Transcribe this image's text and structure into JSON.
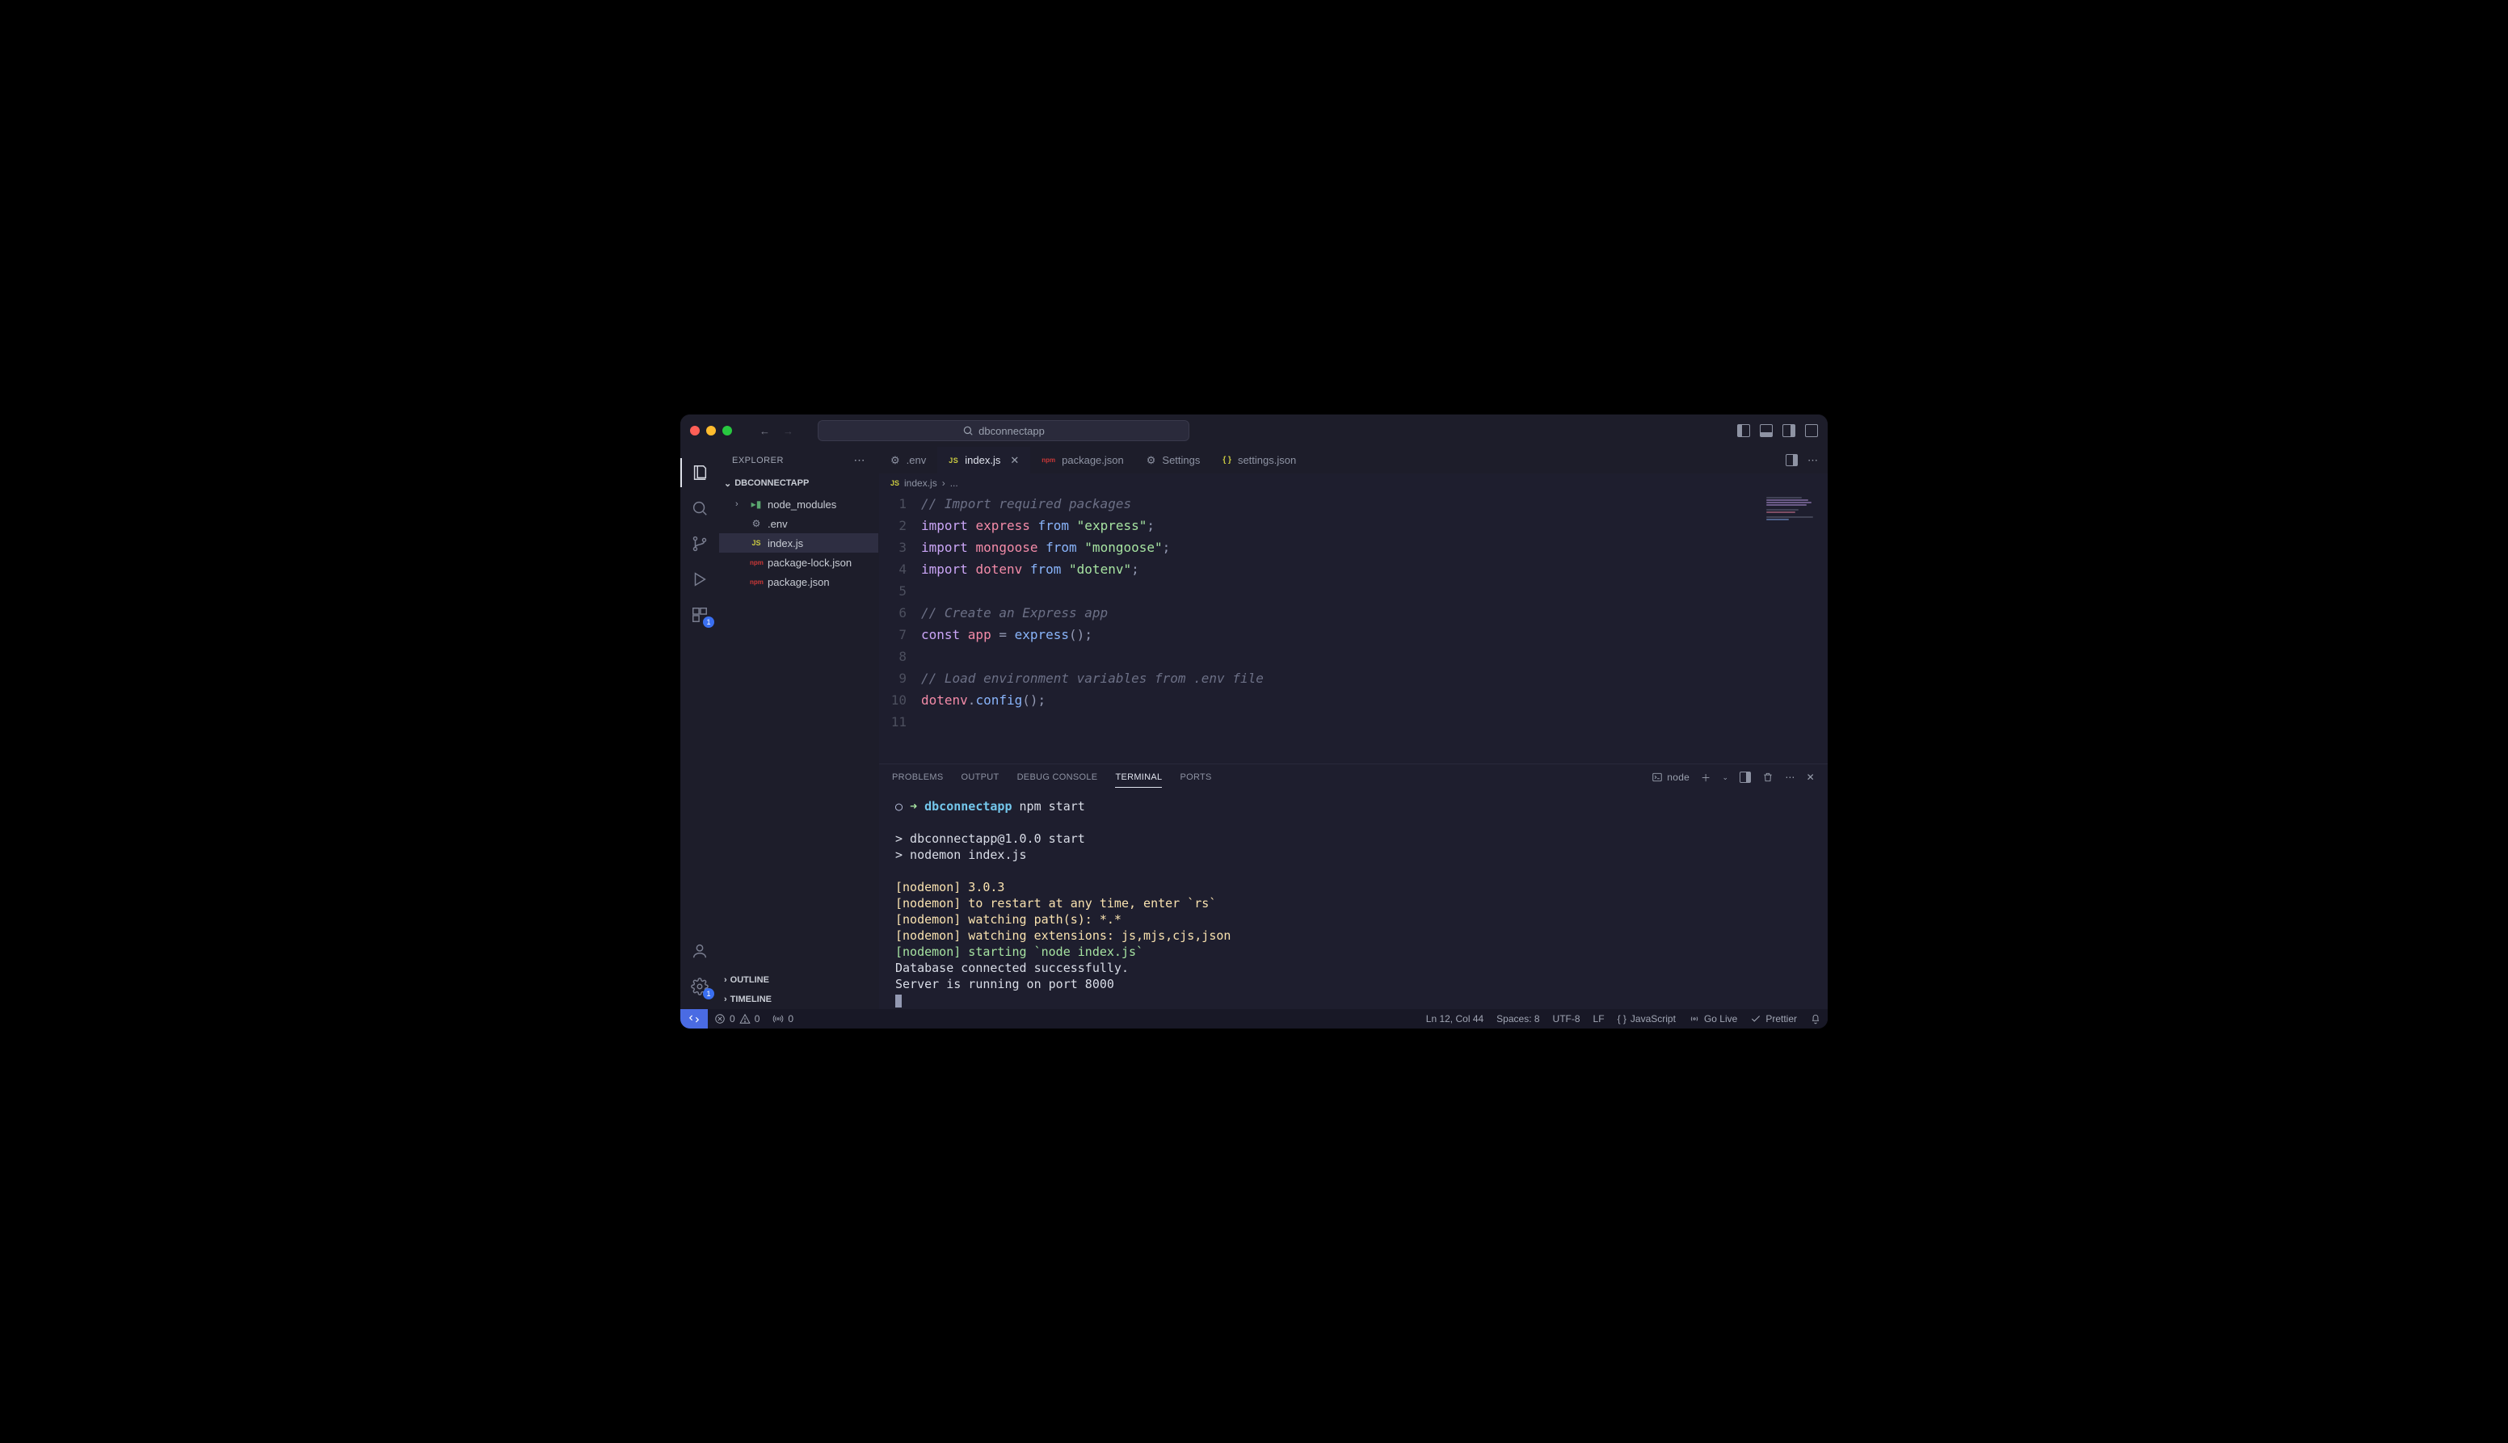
{
  "titlebar": {
    "search_text": "dbconnectapp"
  },
  "activitybar": {
    "extensions_badge": "1",
    "settings_badge": "1"
  },
  "sidebar": {
    "header": "EXPLORER",
    "section": "DBCONNECTAPP",
    "files": [
      {
        "kind": "folder",
        "name": "node_modules",
        "chev": "›"
      },
      {
        "kind": "gear",
        "name": ".env"
      },
      {
        "kind": "js",
        "name": "index.js",
        "selected": true
      },
      {
        "kind": "npm",
        "name": "package-lock.json"
      },
      {
        "kind": "npm",
        "name": "package.json"
      }
    ],
    "bottom": [
      "OUTLINE",
      "TIMELINE"
    ]
  },
  "tabs": [
    {
      "icon": "gear",
      "label": ".env"
    },
    {
      "icon": "js",
      "label": "index.js",
      "active": true,
      "closeable": true
    },
    {
      "icon": "npm",
      "label": "package.json"
    },
    {
      "icon": "sliders",
      "label": "Settings"
    },
    {
      "icon": "braces",
      "label": "settings.json"
    }
  ],
  "breadcrumbs": {
    "file_icon": "JS",
    "file": "index.js",
    "sep": "›",
    "tail": "..."
  },
  "editor": {
    "lines": [
      {
        "n": 1,
        "seg": [
          {
            "c": "c-comment",
            "t": "// Import required packages"
          }
        ]
      },
      {
        "n": 2,
        "seg": [
          {
            "c": "c-kw",
            "t": "import "
          },
          {
            "c": "c-id",
            "t": "express"
          },
          {
            "c": "c-kw2",
            "t": " from "
          },
          {
            "c": "c-str",
            "t": "\"express\""
          },
          {
            "c": "c-punc",
            "t": ";"
          }
        ]
      },
      {
        "n": 3,
        "seg": [
          {
            "c": "c-kw",
            "t": "import "
          },
          {
            "c": "c-id",
            "t": "mongoose"
          },
          {
            "c": "c-kw2",
            "t": " from "
          },
          {
            "c": "c-str",
            "t": "\"mongoose\""
          },
          {
            "c": "c-punc",
            "t": ";"
          }
        ]
      },
      {
        "n": 4,
        "seg": [
          {
            "c": "c-kw",
            "t": "import "
          },
          {
            "c": "c-id",
            "t": "dotenv"
          },
          {
            "c": "c-kw2",
            "t": " from "
          },
          {
            "c": "c-str",
            "t": "\"dotenv\""
          },
          {
            "c": "c-punc",
            "t": ";"
          }
        ]
      },
      {
        "n": 5,
        "seg": []
      },
      {
        "n": 6,
        "seg": [
          {
            "c": "c-comment",
            "t": "// Create an Express app"
          }
        ]
      },
      {
        "n": 7,
        "seg": [
          {
            "c": "c-kw",
            "t": "const "
          },
          {
            "c": "c-id",
            "t": "app"
          },
          {
            "c": "c-punc",
            "t": " = "
          },
          {
            "c": "c-fn",
            "t": "express"
          },
          {
            "c": "c-punc",
            "t": "();"
          }
        ]
      },
      {
        "n": 8,
        "seg": []
      },
      {
        "n": 9,
        "seg": [
          {
            "c": "c-comment",
            "t": "// Load environment variables from .env file"
          }
        ]
      },
      {
        "n": 10,
        "seg": [
          {
            "c": "c-id",
            "t": "dotenv"
          },
          {
            "c": "c-punc",
            "t": "."
          },
          {
            "c": "c-fn",
            "t": "config"
          },
          {
            "c": "c-punc",
            "t": "();"
          }
        ]
      },
      {
        "n": 11,
        "seg": []
      }
    ]
  },
  "panel": {
    "tabs": [
      "PROBLEMS",
      "OUTPUT",
      "DEBUG CONSOLE",
      "TERMINAL",
      "PORTS"
    ],
    "active": "TERMINAL",
    "profile": "node",
    "prompt": {
      "symbol": "➜",
      "cwd": "dbconnectapp",
      "cmd": "npm start"
    },
    "lines": [
      {
        "cls": "",
        "t": ""
      },
      {
        "cls": "",
        "t": "> dbconnectapp@1.0.0 start"
      },
      {
        "cls": "",
        "t": "> nodemon index.js"
      },
      {
        "cls": "",
        "t": ""
      },
      {
        "cls": "t-yellow",
        "t": "[nodemon] 3.0.3"
      },
      {
        "cls": "t-yellow",
        "t": "[nodemon] to restart at any time, enter `rs`"
      },
      {
        "cls": "t-yellow",
        "t": "[nodemon] watching path(s): *.*"
      },
      {
        "cls": "t-yellow",
        "t": "[nodemon] watching extensions: js,mjs,cjs,json"
      },
      {
        "cls": "t-green",
        "t": "[nodemon] starting `node index.js`"
      },
      {
        "cls": "",
        "t": "Database connected successfully."
      },
      {
        "cls": "",
        "t": "Server is running on port 8000"
      }
    ]
  },
  "status": {
    "errors": "0",
    "warnings": "0",
    "ports": "0",
    "pos": "Ln 12, Col 44",
    "spaces": "Spaces: 8",
    "encoding": "UTF-8",
    "eol": "LF",
    "lang_icon": "{ }",
    "lang": "JavaScript",
    "golive": "Go Live",
    "prettier": "Prettier"
  }
}
